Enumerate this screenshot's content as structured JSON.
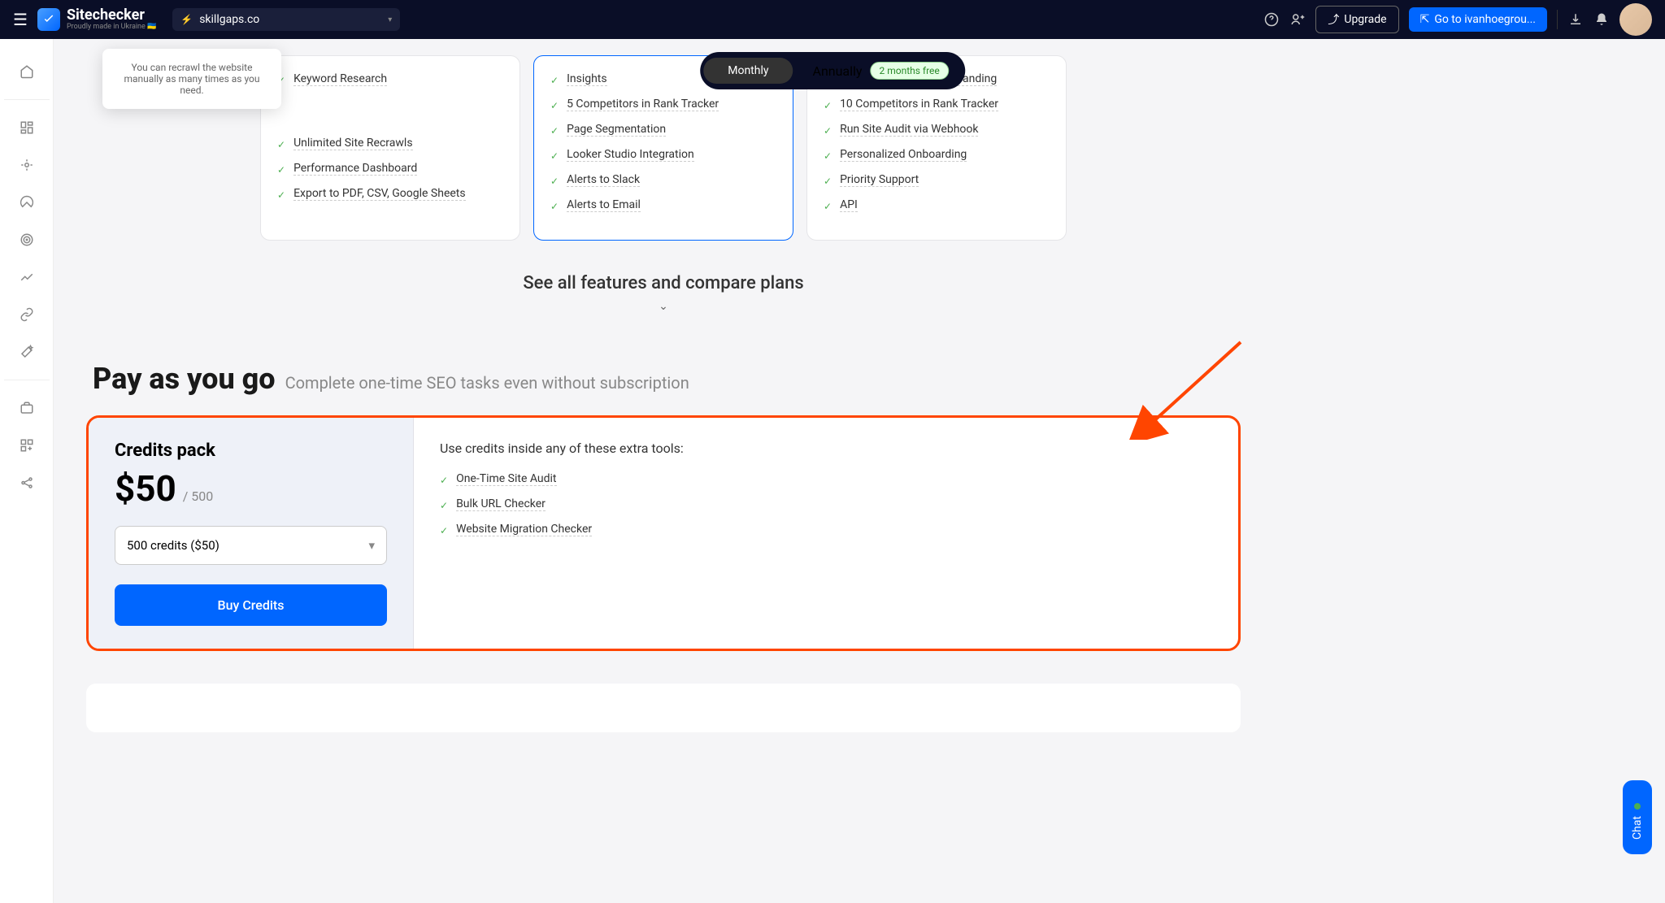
{
  "header": {
    "logo_name": "Sitechecker",
    "logo_tagline": "Proudly made in Ukraine 🇺🇦",
    "site": "skillgaps.co",
    "upgrade": "Upgrade",
    "goto": "Go to ivanhoegrou..."
  },
  "billing": {
    "monthly": "Monthly",
    "annually": "Annually",
    "badge": "2 months free"
  },
  "tooltip": "You can recrawl the website manually as many times as you need.",
  "plans": {
    "col1": [
      "Keyword Research",
      "Unlimited Site Recrawls",
      "Performance Dashboard",
      "Export to PDF, CSV, Google Sheets"
    ],
    "col2": [
      "Insights",
      "5 Competitors in Rank Tracker",
      "Page Segmentation",
      "Looker Studio Integration",
      "Alerts to Slack",
      "Alerts to Email"
    ],
    "col3": [
      "App Interface & Email Branding",
      "10 Competitors in Rank Tracker",
      "Run Site Audit via Webhook",
      "Personalized Onboarding",
      "Priority Support",
      "API"
    ]
  },
  "compare": "See all features and compare plans",
  "payg": {
    "title": "Pay as you go",
    "subtitle": "Complete one-time SEO tasks even without subscription"
  },
  "credits": {
    "pack_title": "Credits pack",
    "price": "$50",
    "per": "/ 500",
    "select": "500 credits ($50)",
    "buy": "Buy Credits",
    "tools_heading": "Use credits inside any of these extra tools:",
    "tools": [
      "One-Time Site Audit",
      "Bulk URL Checker",
      "Website Migration Checker"
    ]
  },
  "chat": "Chat"
}
